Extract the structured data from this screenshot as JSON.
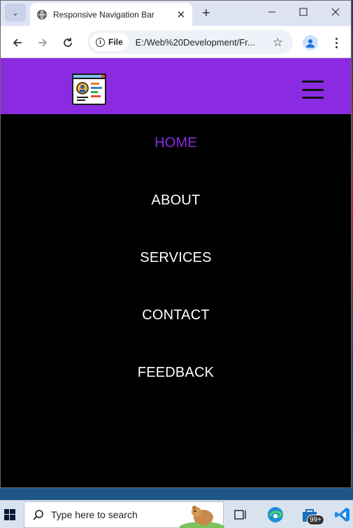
{
  "browser": {
    "tab_title": "Responsive Navigation Bar",
    "url_chip": "File",
    "url": "E:/Web%20Development/Fr..."
  },
  "site": {
    "nav_items": [
      {
        "label": "HOME",
        "active": true
      },
      {
        "label": "ABOUT",
        "active": false
      },
      {
        "label": "SERVICES",
        "active": false
      },
      {
        "label": "CONTACT",
        "active": false
      },
      {
        "label": "FEEDBACK",
        "active": false
      }
    ],
    "colors": {
      "accent": "#8a2be2",
      "menu_bg": "#000000",
      "menu_text": "#ffffff"
    }
  },
  "taskbar": {
    "search_placeholder": "Type here to search",
    "notification_badge": "99+"
  },
  "icons": [
    "tab-list-icon",
    "globe-icon",
    "close-icon",
    "plus-icon",
    "minimize-icon",
    "maximize-icon",
    "back-icon",
    "forward-icon",
    "reload-icon",
    "info-icon",
    "star-icon",
    "profile-icon",
    "more-icon",
    "logo-icon",
    "hamburger-icon",
    "windows-icon",
    "search-icon",
    "task-view-icon",
    "edge-icon",
    "store-icon",
    "vscode-icon"
  ]
}
